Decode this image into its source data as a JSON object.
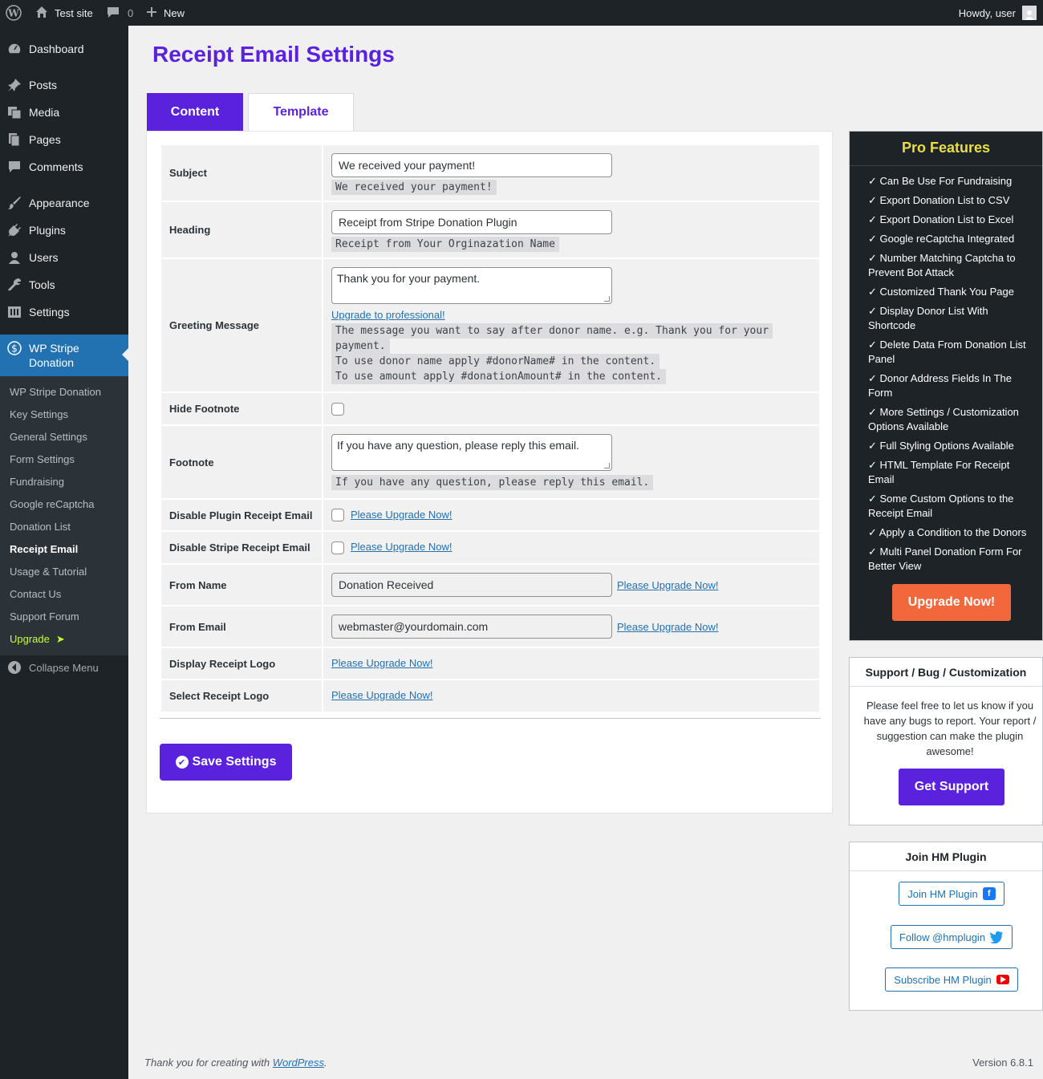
{
  "adminbar": {
    "site_name": "Test site",
    "comments_count": "0",
    "new_label": "New",
    "howdy": "Howdy, user"
  },
  "sidebar": {
    "items": [
      {
        "label": "Dashboard",
        "icon": "dashboard-icon"
      },
      {
        "label": "Posts",
        "icon": "pin-icon"
      },
      {
        "label": "Media",
        "icon": "media-icon"
      },
      {
        "label": "Pages",
        "icon": "pages-icon"
      },
      {
        "label": "Comments",
        "icon": "comment-icon"
      },
      {
        "label": "Appearance",
        "icon": "brush-icon"
      },
      {
        "label": "Plugins",
        "icon": "plug-icon"
      },
      {
        "label": "Users",
        "icon": "user-icon"
      },
      {
        "label": "Tools",
        "icon": "wrench-icon"
      },
      {
        "label": "Settings",
        "icon": "settings-icon"
      }
    ],
    "active": {
      "label": "WP Stripe Donation",
      "icon": "dollar-icon"
    },
    "submenu": [
      "WP Stripe Donation",
      "Key Settings",
      "General Settings",
      "Form Settings",
      "Fundraising",
      "Google reCaptcha",
      "Donation List",
      "Receipt Email",
      "Usage & Tutorial",
      "Contact Us",
      "Support Forum",
      "Upgrade"
    ],
    "collapse": "Collapse Menu"
  },
  "page": {
    "title": "Receipt Email Settings",
    "tabs": [
      "Content",
      "Template"
    ]
  },
  "form": {
    "subject": {
      "label": "Subject",
      "value": "We received your payment!",
      "hint": "We received your payment!"
    },
    "heading": {
      "label": "Heading",
      "value": "Receipt from Stripe Donation Plugin",
      "hint": "Receipt from Your Orginazation Name"
    },
    "greeting": {
      "label": "Greeting Message",
      "value": "Thank you for your payment.",
      "upgrade_link": "Upgrade to professional!",
      "hint1": "The message you want to say after donor name. e.g. Thank you for your",
      "hint1b": "payment.",
      "hint2": "To use donor name apply #donorName# in the content.",
      "hint3": "To use amount apply #donationAmount# in the content."
    },
    "hide_footnote": {
      "label": "Hide Footnote"
    },
    "footnote": {
      "label": "Footnote",
      "value": "If you have any question, please reply this email.",
      "hint": "If you have any question, please reply this email."
    },
    "disable_plugin": {
      "label": "Disable Plugin Receipt Email",
      "link": "Please Upgrade Now!"
    },
    "disable_stripe": {
      "label": "Disable Stripe Receipt Email",
      "link": "Please Upgrade Now!"
    },
    "from_name": {
      "label": "From Name",
      "value": "Donation Received",
      "link": "Please Upgrade Now!"
    },
    "from_email": {
      "label": "From Email",
      "value": "webmaster@yourdomain.com",
      "link": "Please Upgrade Now!"
    },
    "display_logo": {
      "label": "Display Receipt Logo",
      "link": "Please Upgrade Now!"
    },
    "select_logo": {
      "label": "Select Receipt Logo",
      "link": "Please Upgrade Now!"
    },
    "save_label": "Save Settings"
  },
  "pro": {
    "title": "Pro Features",
    "items": [
      "✓ Can Be Use For Fundraising",
      "✓ Export Donation List to CSV",
      "✓ Export Donation List to Excel",
      "✓ Google reCaptcha Integrated",
      "✓ Number Matching Captcha to Prevent Bot Attack",
      "✓ Customized Thank You Page",
      "✓ Display Donor List With Shortcode",
      "✓ Delete Data From Donation List Panel",
      "✓ Donor Address Fields In The Form",
      "✓ More Settings / Customization Options Available",
      "✓ Full Styling Options Available",
      "✓ HTML Template For Receipt Email",
      "✓ Some Custom Options to the Receipt Email",
      "✓ Apply a Condition to the Donors",
      "✓ Multi Panel Donation Form For Better View"
    ],
    "button": "Upgrade Now!"
  },
  "support": {
    "title": "Support / Bug / Customization",
    "text": "Please feel free to let us know if you have any bugs to report. Your report / suggestion can make the plugin awesome!",
    "button": "Get Support"
  },
  "join": {
    "title": "Join HM Plugin",
    "facebook": "Join HM Plugin",
    "twitter": "Follow @hmplugin",
    "youtube": "Subscribe HM Plugin"
  },
  "footer": {
    "text_prefix": "Thank you for creating with",
    "link": "WordPress",
    "suffix": ".",
    "version": "Version 6.8.1"
  },
  "colors": {
    "accent": "#5a22dd",
    "pro_title": "#e8de45",
    "upgrade_button": "#f2673c",
    "admin_dark": "#1d2327",
    "wp_blue": "#2271b1"
  }
}
